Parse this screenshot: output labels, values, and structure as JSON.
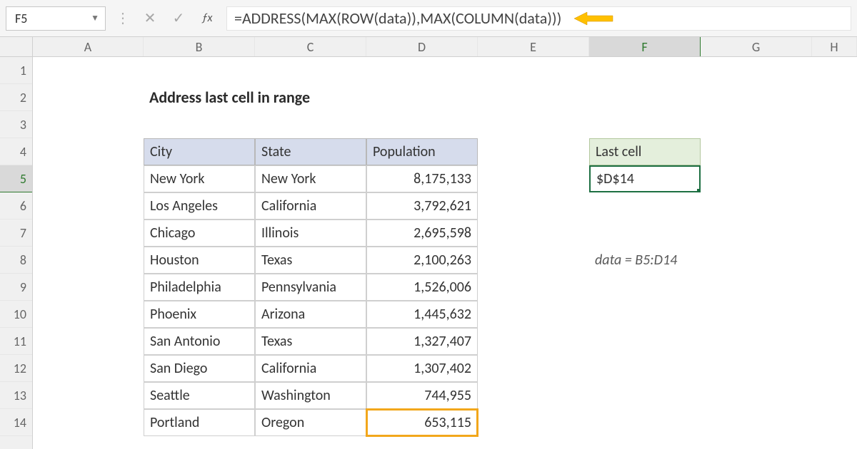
{
  "nameBox": "F5",
  "formula": "=ADDRESS(MAX(ROW(data)),MAX(COLUMN(data)))",
  "columns": [
    "A",
    "B",
    "C",
    "D",
    "E",
    "F",
    "G",
    "H"
  ],
  "rows": [
    "1",
    "2",
    "3",
    "4",
    "5",
    "6",
    "7",
    "8",
    "9",
    "10",
    "11",
    "12",
    "13",
    "14"
  ],
  "selectedCol": "F",
  "selectedRow": "5",
  "title": "Address last cell in range",
  "tableHeaders": {
    "city": "City",
    "state": "State",
    "pop": "Population"
  },
  "tableRows": [
    {
      "city": "New York",
      "state": "New York",
      "pop": "8,175,133"
    },
    {
      "city": "Los Angeles",
      "state": "California",
      "pop": "3,792,621"
    },
    {
      "city": "Chicago",
      "state": "Illinois",
      "pop": "2,695,598"
    },
    {
      "city": "Houston",
      "state": "Texas",
      "pop": "2,100,263"
    },
    {
      "city": "Philadelphia",
      "state": "Pennsylvania",
      "pop": "1,526,006"
    },
    {
      "city": "Phoenix",
      "state": "Arizona",
      "pop": "1,445,632"
    },
    {
      "city": "San Antonio",
      "state": "Texas",
      "pop": "1,327,407"
    },
    {
      "city": "San Diego",
      "state": "California",
      "pop": "1,307,402"
    },
    {
      "city": "Seattle",
      "state": "Washington",
      "pop": "744,955"
    },
    {
      "city": "Portland",
      "state": "Oregon",
      "pop": "653,115"
    }
  ],
  "resultHeader": "Last cell",
  "resultValue": "$D$14",
  "note": "data = B5:D14"
}
